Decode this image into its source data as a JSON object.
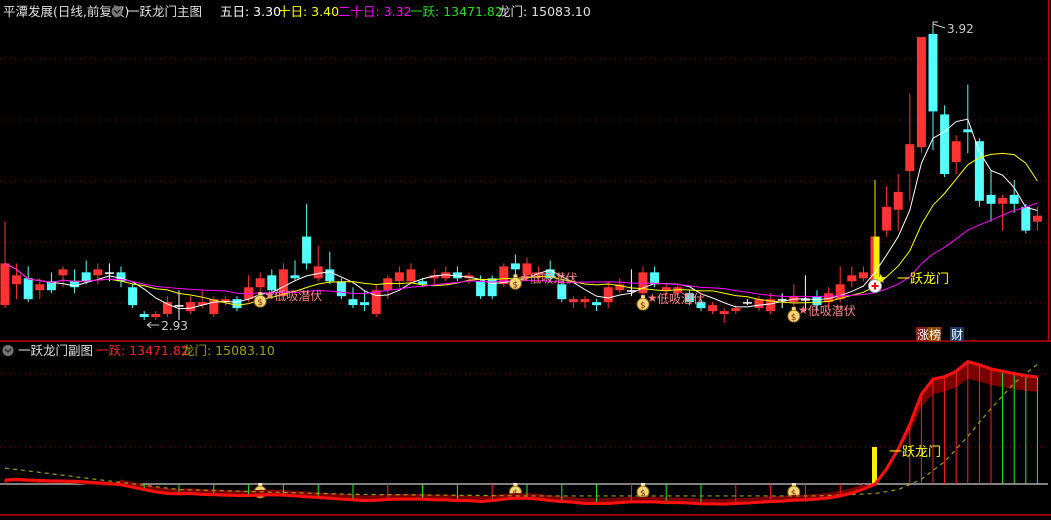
{
  "main_header": {
    "stock": "平潭发展(日线,前复权)",
    "indicator": "一跃龙门主图",
    "ma5_label": "五日: 3.30",
    "ma10_label": "十日: 3.40",
    "ma20_label": "二十日: 3.32",
    "yiyue_label": "一跃: 13471.82",
    "longmen_label": "龙门: 15083.10"
  },
  "sub_header": {
    "indicator": "一跃龙门副图",
    "yiyue_label": "一跃: 13471.82",
    "longmen_label": "龙门: 15083.10"
  },
  "annotations": {
    "high_label": "3.92",
    "low_label": "2.93",
    "signal_label": "一跃龙门",
    "buy_label": "低吸潜伏",
    "buy_indices": [
      22,
      44,
      55,
      68
    ],
    "signal_index": 75,
    "high_index": 80,
    "low_index": 12
  },
  "badges": {
    "rank": "涨榜",
    "finance": "财"
  },
  "colors": {
    "up": "#ff3333",
    "down": "#54ffff",
    "ma5": "#ffffff",
    "ma10": "#ffff00",
    "ma20": "#ff00ff",
    "longmen": "#a0a000",
    "grid": "#8b0000"
  },
  "chart_data": {
    "type": "candlestick",
    "price_range": [
      2.93,
      3.92
    ],
    "candles": [
      [
        2.98,
        3.26,
        2.97,
        3.12
      ],
      [
        3.05,
        3.12,
        3.0,
        3.08
      ],
      [
        3.07,
        3.11,
        2.99,
        3.0
      ],
      [
        3.03,
        3.07,
        3.0,
        3.05
      ],
      [
        3.06,
        3.09,
        3.02,
        3.03
      ],
      [
        3.08,
        3.11,
        3.04,
        3.1
      ],
      [
        3.06,
        3.1,
        3.02,
        3.04
      ],
      [
        3.09,
        3.13,
        3.05,
        3.06
      ],
      [
        3.08,
        3.12,
        3.05,
        3.1
      ],
      [
        3.09,
        3.12,
        3.06,
        3.09
      ],
      [
        3.09,
        3.11,
        3.04,
        3.06
      ],
      [
        3.04,
        3.05,
        2.97,
        2.98
      ],
      [
        2.95,
        2.96,
        2.93,
        2.94
      ],
      [
        2.94,
        2.96,
        2.93,
        2.95
      ],
      [
        2.95,
        3.01,
        2.94,
        2.99
      ],
      [
        2.98,
        3.03,
        2.93,
        2.98
      ],
      [
        2.96,
        3.01,
        2.95,
        2.99
      ],
      [
        2.98,
        3.03,
        2.97,
        2.99
      ],
      [
        2.95,
        3.01,
        2.94,
        3.0
      ],
      [
        2.99,
        3.01,
        2.98,
        3.0
      ],
      [
        3.0,
        3.01,
        2.96,
        2.97
      ],
      [
        3.0,
        3.08,
        2.99,
        3.04
      ],
      [
        3.04,
        3.09,
        3.02,
        3.07
      ],
      [
        3.08,
        3.1,
        3.0,
        3.03
      ],
      [
        3.01,
        3.12,
        3.0,
        3.1
      ],
      [
        3.08,
        3.13,
        3.06,
        3.07
      ],
      [
        3.21,
        3.32,
        3.1,
        3.12
      ],
      [
        3.07,
        3.18,
        3.06,
        3.11
      ],
      [
        3.1,
        3.16,
        3.05,
        3.06
      ],
      [
        3.06,
        3.07,
        3.0,
        3.01
      ],
      [
        3.0,
        3.04,
        2.97,
        2.98
      ],
      [
        2.99,
        3.03,
        2.96,
        2.98
      ],
      [
        2.95,
        3.05,
        2.94,
        3.03
      ],
      [
        3.03,
        3.08,
        3.0,
        3.07
      ],
      [
        3.06,
        3.11,
        3.04,
        3.09
      ],
      [
        3.06,
        3.12,
        3.05,
        3.1
      ],
      [
        3.06,
        3.07,
        3.04,
        3.05
      ],
      [
        3.07,
        3.1,
        3.05,
        3.08
      ],
      [
        3.07,
        3.11,
        3.06,
        3.09
      ],
      [
        3.09,
        3.11,
        3.06,
        3.07
      ],
      [
        3.07,
        3.09,
        3.05,
        3.08
      ],
      [
        3.06,
        3.08,
        3.0,
        3.01
      ],
      [
        3.07,
        3.08,
        3.0,
        3.01
      ],
      [
        3.05,
        3.12,
        3.04,
        3.11
      ],
      [
        3.12,
        3.15,
        3.08,
        3.1
      ],
      [
        3.08,
        3.14,
        3.07,
        3.12
      ],
      [
        3.08,
        3.11,
        3.06,
        3.09
      ],
      [
        3.1,
        3.13,
        3.06,
        3.07
      ],
      [
        3.05,
        3.06,
        2.99,
        3.0
      ],
      [
        2.99,
        3.01,
        2.97,
        3.0
      ],
      [
        2.99,
        3.01,
        2.97,
        3.0
      ],
      [
        2.99,
        3.0,
        2.96,
        2.98
      ],
      [
        2.99,
        3.06,
        2.97,
        3.04
      ],
      [
        3.03,
        3.07,
        3.02,
        3.05
      ],
      [
        3.03,
        3.1,
        3.01,
        3.03
      ],
      [
        3.02,
        3.11,
        3.01,
        3.09
      ],
      [
        3.09,
        3.11,
        3.04,
        3.05
      ],
      [
        3.03,
        3.05,
        3.01,
        3.04
      ],
      [
        3.02,
        3.05,
        3.01,
        3.04
      ],
      [
        3.02,
        3.03,
        2.98,
        2.99
      ],
      [
        2.99,
        3.0,
        2.96,
        2.97
      ],
      [
        2.96,
        2.99,
        2.95,
        2.98
      ],
      [
        2.95,
        2.97,
        2.92,
        2.96
      ],
      [
        2.96,
        2.98,
        2.95,
        2.97
      ],
      [
        2.99,
        3.0,
        2.98,
        2.99
      ],
      [
        2.97,
        3.01,
        2.96,
        3.0
      ],
      [
        2.96,
        3.02,
        2.95,
        3.0
      ],
      [
        3.0,
        3.02,
        2.97,
        3.0
      ],
      [
        2.99,
        3.05,
        2.97,
        3.01
      ],
      [
        3.0,
        3.08,
        2.96,
        3.0
      ],
      [
        3.01,
        3.03,
        2.96,
        2.98
      ],
      [
        2.99,
        3.04,
        2.97,
        3.02
      ],
      [
        3.0,
        3.11,
        2.99,
        3.05
      ],
      [
        3.06,
        3.11,
        3.04,
        3.08
      ],
      [
        3.07,
        3.11,
        3.06,
        3.09
      ],
      [
        3.06,
        3.4,
        3.06,
        3.21
      ],
      [
        3.23,
        3.38,
        3.21,
        3.31
      ],
      [
        3.3,
        3.42,
        3.23,
        3.36
      ],
      [
        3.43,
        3.69,
        3.33,
        3.52
      ],
      [
        3.51,
        3.88,
        3.49,
        3.88
      ],
      [
        3.89,
        3.92,
        3.5,
        3.63
      ],
      [
        3.62,
        3.65,
        3.41,
        3.42
      ],
      [
        3.46,
        3.55,
        3.42,
        3.53
      ],
      [
        3.57,
        3.72,
        3.49,
        3.56
      ],
      [
        3.53,
        3.54,
        3.31,
        3.33
      ],
      [
        3.35,
        3.43,
        3.26,
        3.32
      ],
      [
        3.32,
        3.35,
        3.23,
        3.34
      ],
      [
        3.35,
        3.4,
        3.29,
        3.32
      ],
      [
        3.31,
        3.32,
        3.22,
        3.23
      ],
      [
        3.26,
        3.31,
        3.23,
        3.28
      ]
    ],
    "yiyue": [
      500,
      600,
      500,
      450,
      400,
      380,
      350,
      250,
      150,
      50,
      -100,
      -400,
      -700,
      -1000,
      -1200,
      -1250,
      -1200,
      -1300,
      -1350,
      -1400,
      -1450,
      -1450,
      -1400,
      -1350,
      -1400,
      -1500,
      -1600,
      -1700,
      -1800,
      -1900,
      -2000,
      -2100,
      -2050,
      -1950,
      -1900,
      -1900,
      -1900,
      -2000,
      -2000,
      -2100,
      -2100,
      -2200,
      -2100,
      -1900,
      -1800,
      -1800,
      -1900,
      -2100,
      -2200,
      -2300,
      -2450,
      -2450,
      -2450,
      -2350,
      -2250,
      -2250,
      -2250,
      -2350,
      -2350,
      -2400,
      -2500,
      -2500,
      -2550,
      -2450,
      -2400,
      -2300,
      -2200,
      -2150,
      -2050,
      -2000,
      -1900,
      -1750,
      -1500,
      -1150,
      -650,
      0,
      1900,
      4400,
      7500,
      11300,
      13200,
      13500,
      14200,
      15400,
      15000,
      14500,
      14200,
      13900,
      13650,
      13471.82
    ],
    "longmen": [
      [
        0,
        2000
      ],
      [
        15,
        -700
      ],
      [
        30,
        -1300
      ],
      [
        45,
        -1500
      ],
      [
        70,
        -1500
      ],
      [
        75,
        -1200
      ],
      [
        77,
        -700
      ],
      [
        79,
        600
      ],
      [
        81,
        2800
      ],
      [
        83,
        6000
      ],
      [
        85,
        9500
      ],
      [
        87,
        12700
      ],
      [
        89,
        15083.1
      ]
    ],
    "value_range": [
      -3200,
      16000
    ]
  }
}
